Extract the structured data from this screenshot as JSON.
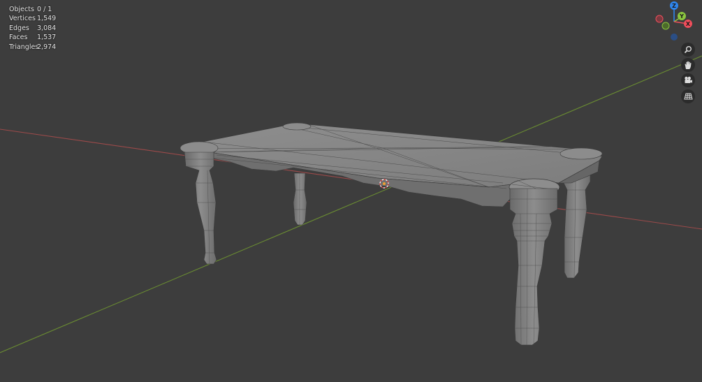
{
  "stats": {
    "rows": [
      {
        "label": "Objects",
        "value": "0 / 1"
      },
      {
        "label": "Vertices",
        "value": "1,549"
      },
      {
        "label": "Edges",
        "value": "3,084"
      },
      {
        "label": "Faces",
        "value": "1,537"
      },
      {
        "label": "Triangles",
        "value": "2,974"
      }
    ]
  },
  "gizmo": {
    "z_label": "Z",
    "y_label": "Y",
    "x_label": "X",
    "z_color": "#2f86ee",
    "y_color": "#8bc53f",
    "x_color": "#f04e5b"
  },
  "nav_buttons": [
    {
      "icon": "zoom-icon"
    },
    {
      "icon": "hand-pan-icon"
    },
    {
      "icon": "camera-icon"
    },
    {
      "icon": "grid-perspective-icon"
    }
  ],
  "colors": {
    "background": "#3d3d3d",
    "x_axis_line": "#9c4a4a",
    "y_axis_line": "#6a8c32"
  }
}
